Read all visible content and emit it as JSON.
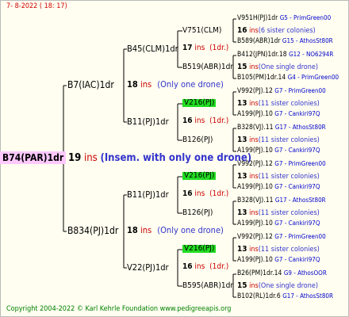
{
  "header": {
    "date": "7-  8-2022 ( 18: 17)"
  },
  "footer": {
    "text": "Copyright 2004-2022 © Karl Kehrle Foundation    www.pedigreeapis.org"
  },
  "root": {
    "name": "B74(PAR)1dr",
    "num": "19",
    "ins": "ins",
    "detail": "(Insem. with only one drone)"
  },
  "gen1": [
    {
      "name": "B7(IAC)1dr",
      "num": "18",
      "ins": "ins",
      "detail": "(Only one drone)"
    },
    {
      "name": "B834(PJ)1dr",
      "num": "18",
      "ins": "ins",
      "detail": "(Only one drone)"
    }
  ],
  "gen2": [
    {
      "name": "B45(CLM)1dr",
      "num": "17",
      "ins": "ins",
      "detail": "(1dr.)"
    },
    {
      "name": "B11(PJ)1dr",
      "num": "16",
      "ins": "ins",
      "detail": "(1dr.)"
    },
    {
      "name": "B11(PJ)1dr",
      "num": "16",
      "ins": "ins",
      "detail": "(1dr.)"
    },
    {
      "name": "V22(PJ)1dr",
      "num": "16",
      "ins": "ins",
      "detail": "(1dr.)"
    }
  ],
  "gen3": [
    {
      "name": "V751(CLM)",
      "num": "16",
      "ins": "ins",
      "detail": "(6 sister colonies)"
    },
    {
      "name": "B519(ABR)1dr",
      "num": "15",
      "ins": "ins",
      "detail": "(One single drone)"
    },
    {
      "name": "V216(PJ)",
      "num": "13",
      "ins": "ins",
      "detail": "(11 sister colonies)"
    },
    {
      "name": "B126(PJ)",
      "num": "13",
      "ins": "ins",
      "detail": "(11 sister colonies)"
    },
    {
      "name": "V216(PJ)",
      "num": "13",
      "ins": "ins",
      "detail": "(11 sister colonies)"
    },
    {
      "name": "B126(PJ)",
      "num": "13",
      "ins": "ins",
      "detail": "(11 sister colonies)"
    },
    {
      "name": "V216(PJ)",
      "num": "13",
      "ins": "ins",
      "detail": "(11 sister colonies)"
    },
    {
      "name": "B595(ABR)1dr",
      "num": "15",
      "ins": "ins",
      "detail": "(One single drone)"
    }
  ],
  "gen4": [
    {
      "name": "V951H(PJ)1dr",
      "ref": "G5 - PrimGreen00"
    },
    {
      "name": "B589(ABR)1dr",
      "ref": "G15 - AthosSt80R"
    },
    {
      "name": "B412(JPN)1dr.18",
      "ref": "G12 - NO6294R"
    },
    {
      "name": "B105(PM)1dr.14",
      "ref": "G4 - PrimGreen00"
    },
    {
      "name": "V992(PJ).12",
      "ref": "G7 - PrimGreen00"
    },
    {
      "name": "A199(PJ).10",
      "ref": "G7 - Cankiri97Q"
    },
    {
      "name": "B328(VJ).11",
      "ref": "G17 - AthosSt80R"
    },
    {
      "name": "A199(PJ).10",
      "ref": "G7 - Cankiri97Q"
    },
    {
      "name": "V992(PJ).12",
      "ref": "G7 - PrimGreen00"
    },
    {
      "name": "A199(PJ).10",
      "ref": "G7 - Cankiri97Q"
    },
    {
      "name": "B328(VJ).11",
      "ref": "G17 - AthosSt80R"
    },
    {
      "name": "A199(PJ).10",
      "ref": "G7 - Cankiri97Q"
    },
    {
      "name": "V992(PJ).12",
      "ref": "G7 - PrimGreen00"
    },
    {
      "name": "A199(PJ).10",
      "ref": "G7 - Cankiri97Q"
    },
    {
      "name": "B26(PM)1dr.14",
      "ref": "G9 - AthosOOR"
    },
    {
      "name": "B102(RL)1dr.6",
      "ref": "G17 - AthosSt80R"
    }
  ]
}
